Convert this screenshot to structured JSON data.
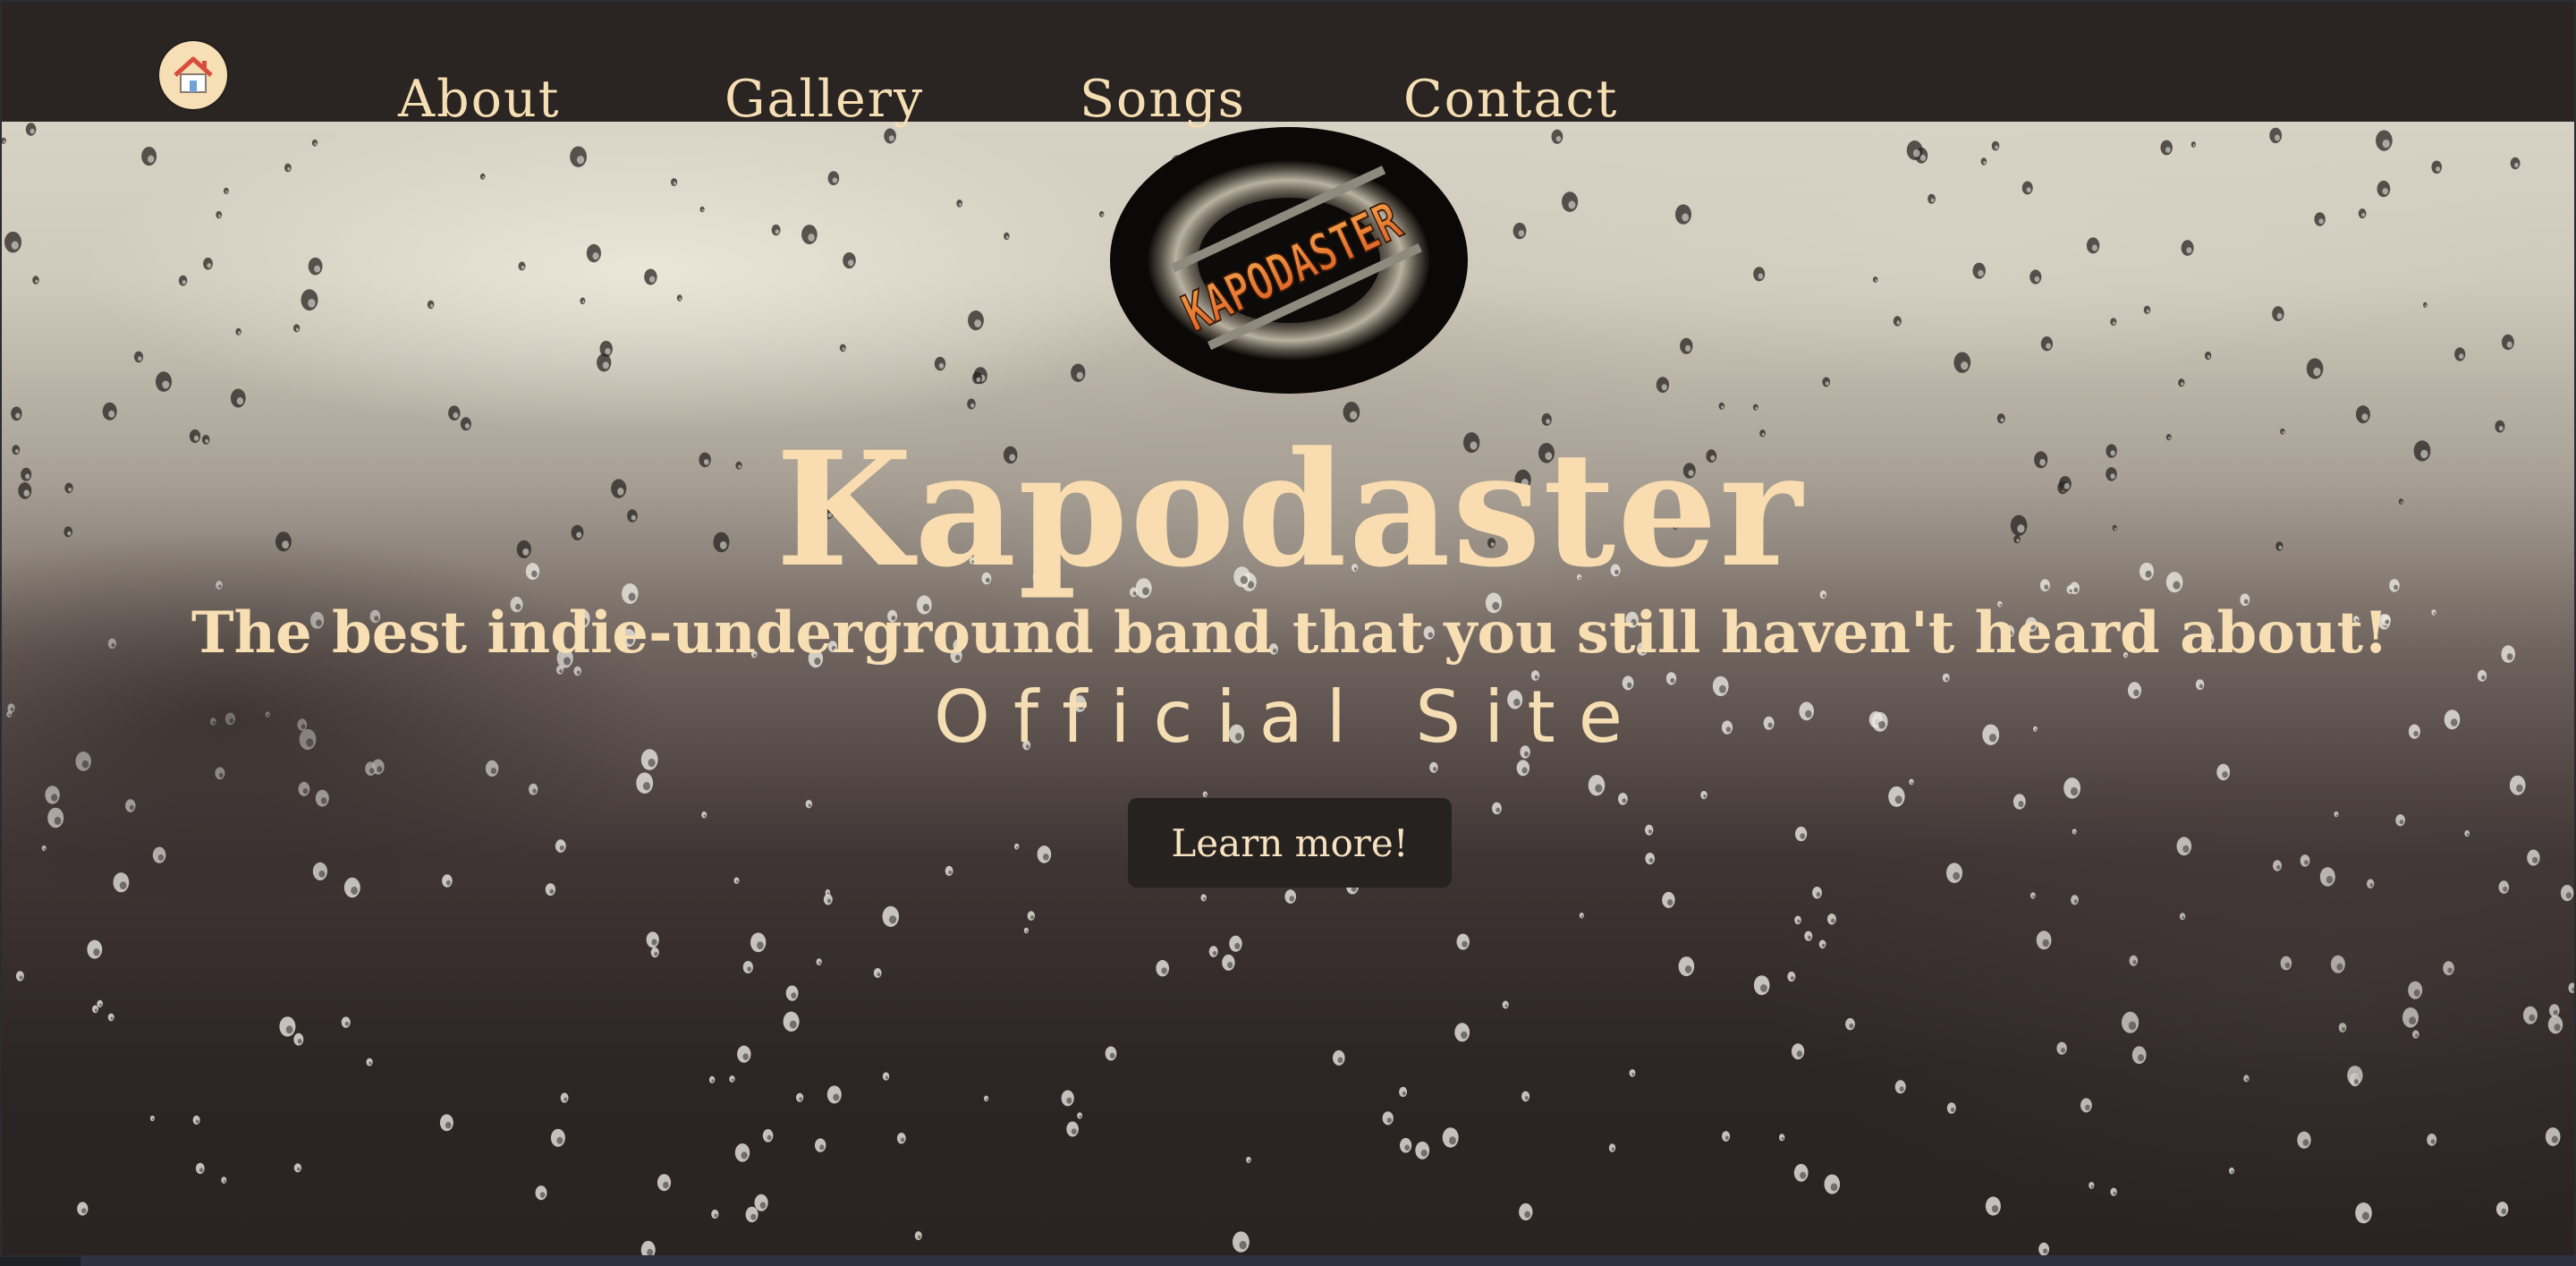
{
  "nav": {
    "home_icon": "home-icon",
    "links": [
      {
        "label": "About"
      },
      {
        "label": "Gallery"
      },
      {
        "label": "Songs"
      },
      {
        "label": "Contact"
      }
    ]
  },
  "logo": {
    "text": "KAPODASTER",
    "icon": "band-logo"
  },
  "hero": {
    "title": "Kapodaster",
    "tagline": "The best indie-underground band that you still haven't heard about!",
    "subtitle": "Official Site",
    "cta_label": "Learn more!"
  },
  "colors": {
    "nav_bg": "#2a2422",
    "accent_text": "#f5deb3",
    "button_bg": "#262220"
  }
}
